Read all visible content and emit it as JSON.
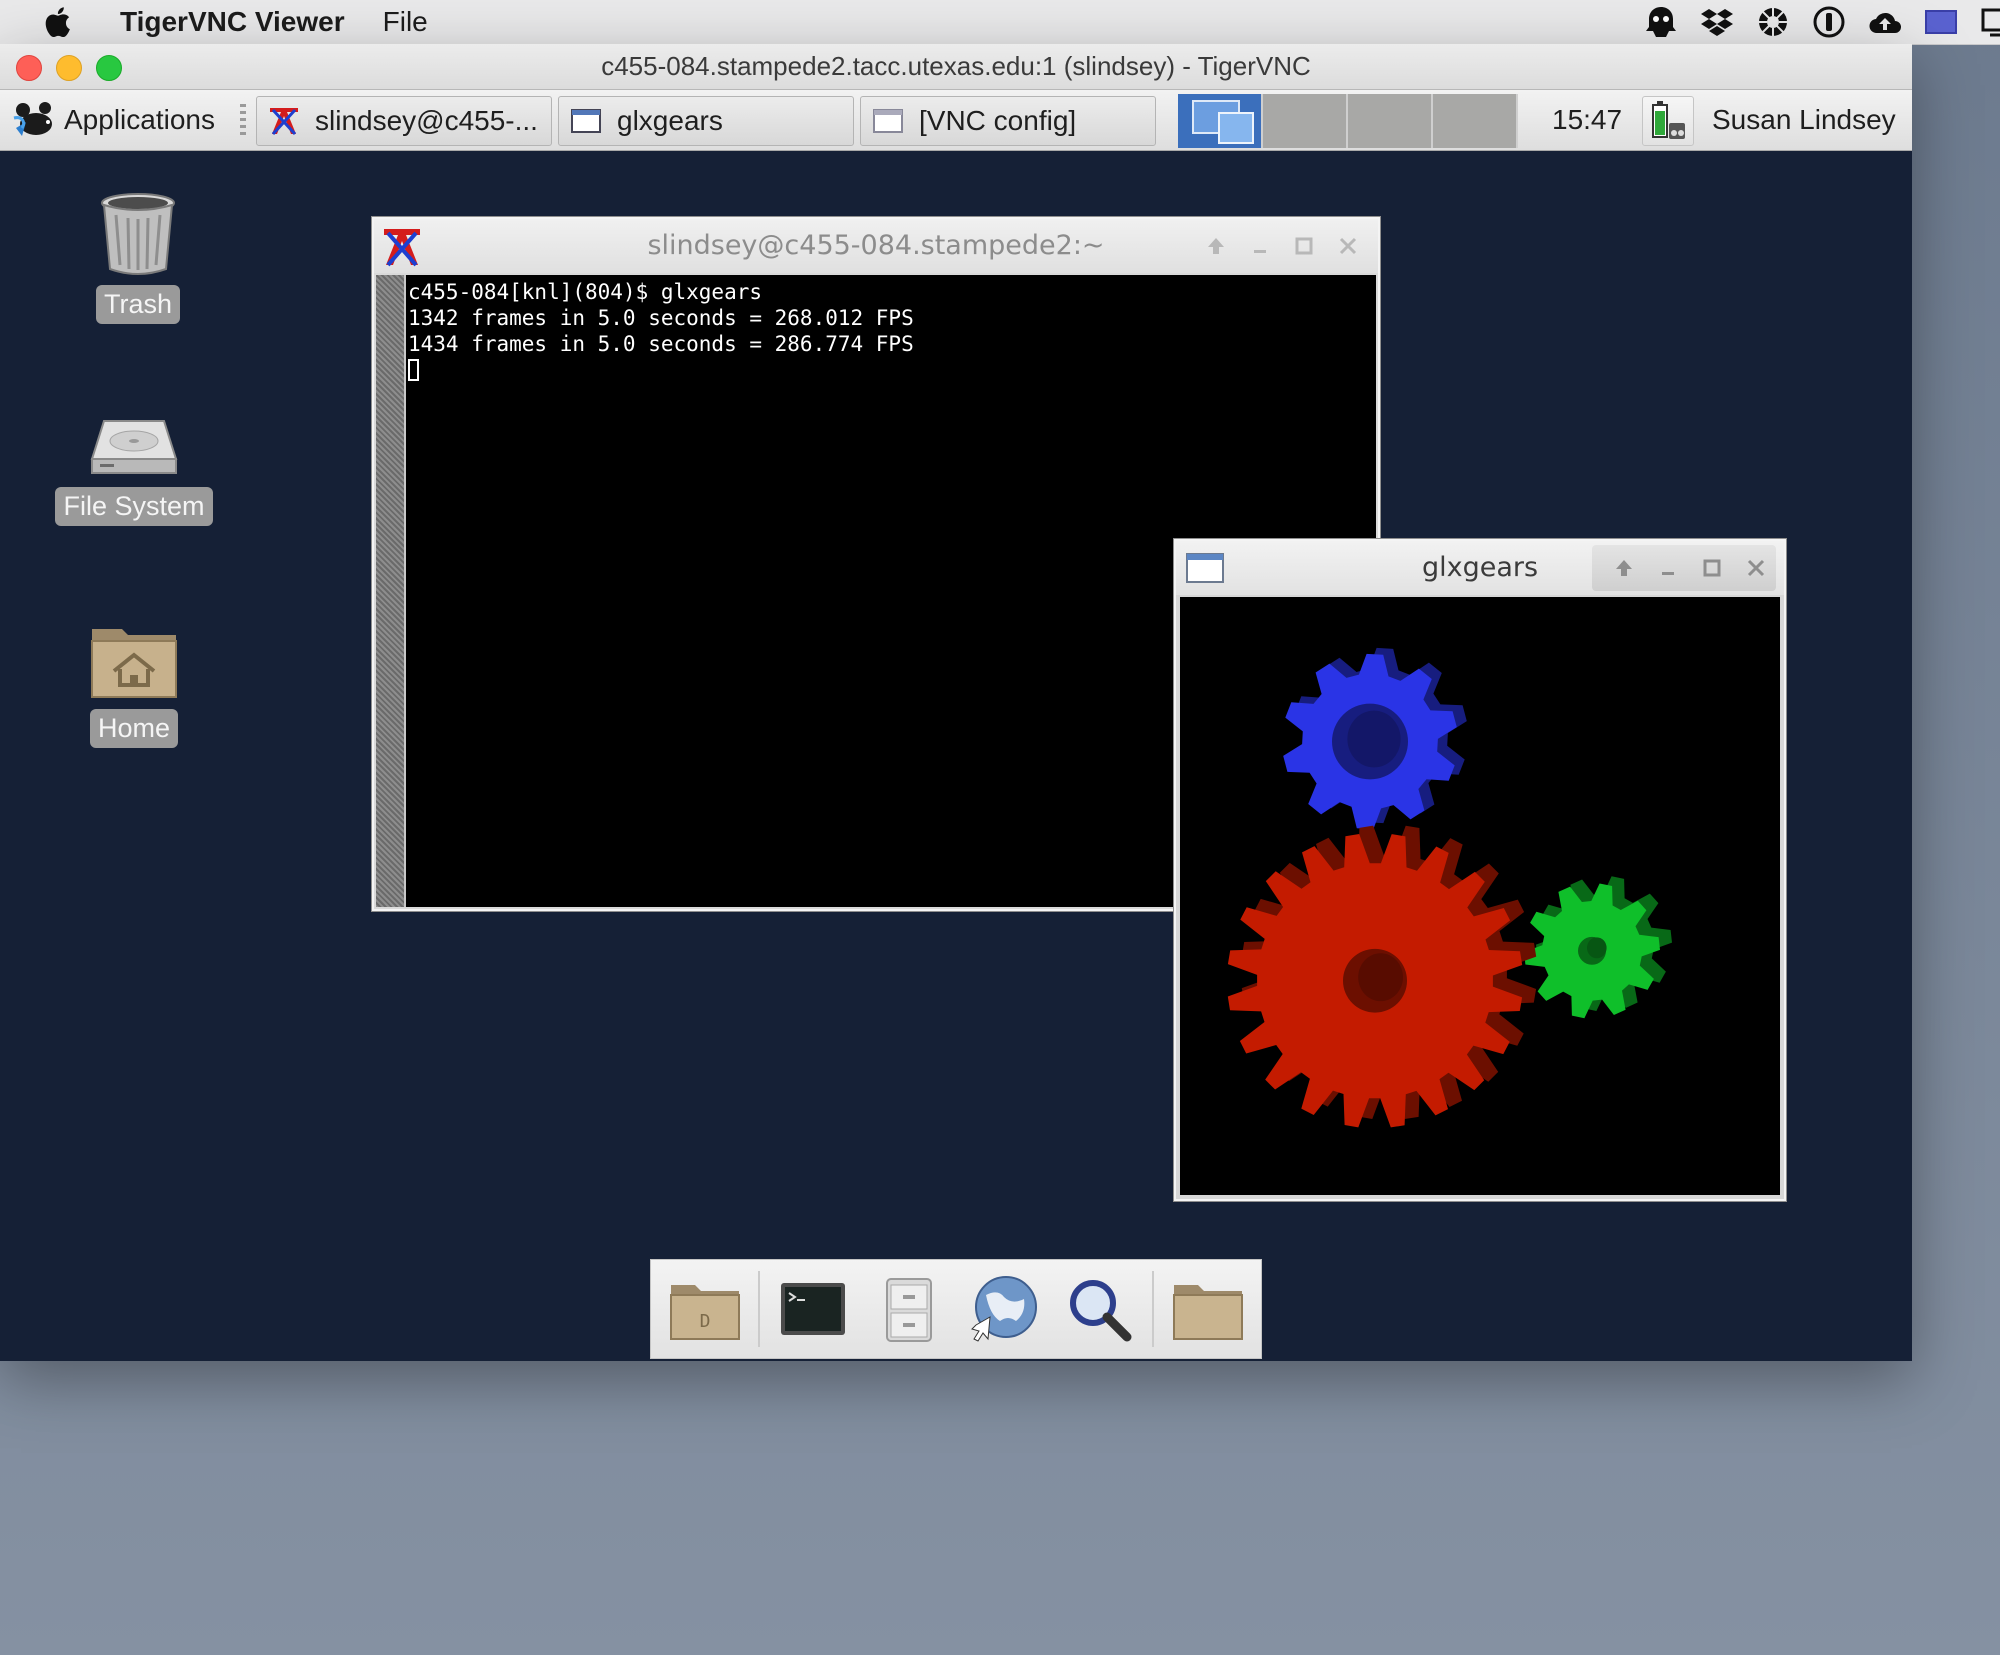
{
  "mac_menubar": {
    "app_name": "TigerVNC Viewer",
    "menus": [
      "File"
    ],
    "tray_icons": [
      "ghost-icon",
      "dropbox-icon",
      "aperture-icon",
      "password-icon",
      "cloud-upload-icon",
      "display-icon",
      "screen-mirror-icon"
    ]
  },
  "vnc_window": {
    "title": "c455-084.stampede2.tacc.utexas.edu:1 (slindsey) - TigerVNC"
  },
  "panel": {
    "applications_label": "Applications",
    "tasks": [
      {
        "label": "slindsey@c455-...",
        "icon": "xterm-icon"
      },
      {
        "label": "glxgears",
        "icon": "window-icon"
      },
      {
        "label": "[VNC config]",
        "icon": "window-icon"
      }
    ],
    "workspaces": 4,
    "active_workspace": 1,
    "clock": "15:47",
    "user": "Susan Lindsey"
  },
  "desktop_icons": [
    {
      "label": "Trash",
      "icon": "trash-icon"
    },
    {
      "label": "File System",
      "icon": "hard-drive-icon"
    },
    {
      "label": "Home",
      "icon": "home-folder-icon"
    }
  ],
  "xterm": {
    "title": "slindsey@c455-084.stampede2:~",
    "lines": [
      "c455-084[knl](804)$ glxgears",
      "1342 frames in 5.0 seconds = 268.012 FPS",
      "1434 frames in 5.0 seconds = 286.774 FPS"
    ]
  },
  "glxgears_window": {
    "title": "glxgears",
    "gear_colors": {
      "red": "#c41b00",
      "green": "#0fbf2a",
      "blue": "#2a34e6"
    }
  },
  "dock": {
    "items": [
      "downloads-folder-icon",
      "terminal-icon",
      "file-cabinet-icon",
      "web-browser-icon",
      "search-icon",
      "folder-icon"
    ]
  },
  "colors": {
    "desktop_bg": "#152036",
    "workspace_active": "#3b6fbc"
  }
}
